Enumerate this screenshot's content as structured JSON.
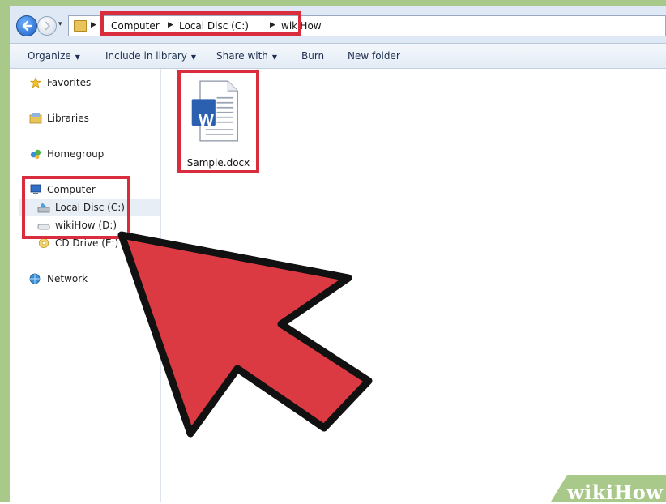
{
  "address": {
    "recent_arrow": "▾",
    "breadcrumbs": [
      "Computer",
      "Local Disc (C:)",
      "wikiHow"
    ]
  },
  "toolbar": {
    "organize": "Organize",
    "include_in_library": "Include in library",
    "share_with": "Share with",
    "burn": "Burn",
    "new_folder": "New folder"
  },
  "sidebar": {
    "favorites": "Favorites",
    "libraries": "Libraries",
    "homegroup": "Homegroup",
    "computer": "Computer",
    "local_disc": "Local Disc (C:)",
    "wikihow_drive": "wikiHow (D:)",
    "cd_drive": "CD Drive (E:)",
    "network": "Network"
  },
  "content": {
    "file_name": "Sample.docx",
    "file_icon_letter": "W"
  },
  "watermark": {
    "wiki": "wiki",
    "how": "How"
  },
  "colors": {
    "highlight": "#d92d3d",
    "arrow_fill": "#dc3a43",
    "frame": "#a9c98a",
    "word_blue": "#2b5fb0"
  },
  "icons": [
    "back-arrow-icon",
    "forward-arrow-icon",
    "folder-icon",
    "star-icon",
    "libraries-icon",
    "homegroup-icon",
    "computer-icon",
    "local-disk-icon",
    "drive-icon",
    "cd-drive-icon",
    "network-icon",
    "word-document-icon",
    "cursor-arrow-icon"
  ]
}
